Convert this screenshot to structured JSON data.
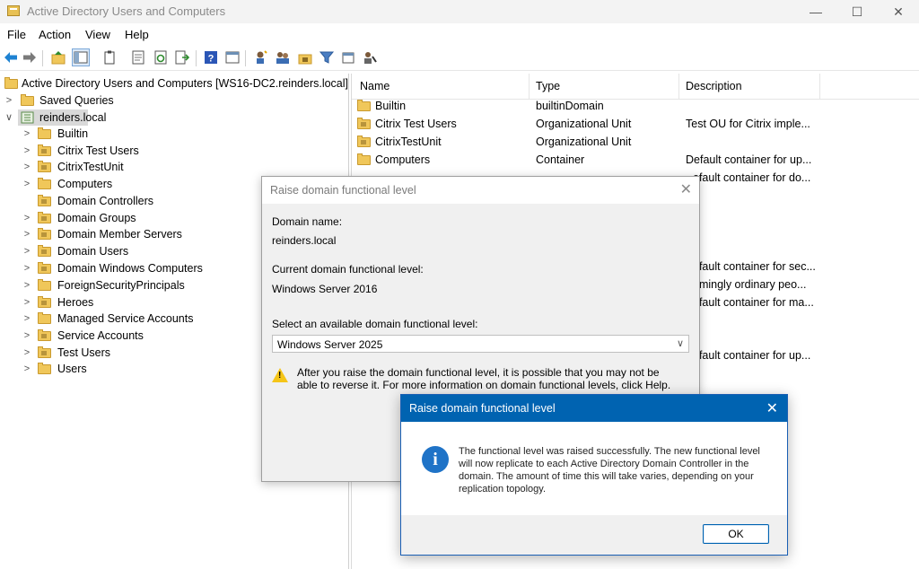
{
  "window": {
    "title": "Active Directory Users and Computers",
    "controls": {
      "minimize": "—",
      "maximize": "☐",
      "close": "✕"
    }
  },
  "menu": [
    "File",
    "Action",
    "View",
    "Help"
  ],
  "tree": {
    "root": "Active Directory Users and Computers [WS16-DC2.reinders.local]",
    "saved_queries": "Saved Queries",
    "domain": "reinders.local",
    "children": [
      "Builtin",
      "Citrix Test Users",
      "CitrixTestUnit",
      "Computers",
      "Domain Controllers",
      "Domain Groups",
      "Domain Member Servers",
      "Domain Users",
      "Domain Windows Computers",
      "ForeignSecurityPrincipals",
      "Heroes",
      "Managed Service Accounts",
      "Service Accounts",
      "Test Users",
      "Users"
    ]
  },
  "list": {
    "columns": [
      "Name",
      "Type",
      "Description"
    ],
    "rows": [
      {
        "name": "Builtin",
        "type": "builtinDomain",
        "description": ""
      },
      {
        "name": "Citrix Test Users",
        "type": "Organizational Unit",
        "description": "Test OU for Citrix imple..."
      },
      {
        "name": "CitrixTestUnit",
        "type": "Organizational Unit",
        "description": ""
      },
      {
        "name": "Computers",
        "type": "Container",
        "description": "Default container for up..."
      },
      {
        "name": "",
        "type": "",
        "description": "efault container for do..."
      }
    ],
    "partial_desc": [
      "efault container for sec...",
      "emingly ordinary peo...",
      "efault container for ma...",
      "efault container for up..."
    ]
  },
  "dialog_raise": {
    "title": "Raise domain functional level",
    "close": "✕",
    "domain_name_label": "Domain name:",
    "domain_name": "reinders.local",
    "current_label": "Current domain functional level:",
    "current_value": "Windows Server 2016",
    "select_label": "Select an available domain functional level:",
    "select_value": "Windows Server 2025",
    "warning": "After you raise the domain functional level, it is possible that you may not be able to reverse it. For more information on domain functional levels, click Help."
  },
  "dialog_info": {
    "title": "Raise domain functional level",
    "close": "✕",
    "icon": "i",
    "message": "The functional level was raised successfully. The new functional level will now replicate to each Active Directory Domain Controller in the domain. The amount of time this will take varies, depending on your replication topology.",
    "ok": "OK"
  },
  "colors": {
    "accent": "#0063b1",
    "folder": "#f0c75a",
    "warning": "#f5c518"
  }
}
